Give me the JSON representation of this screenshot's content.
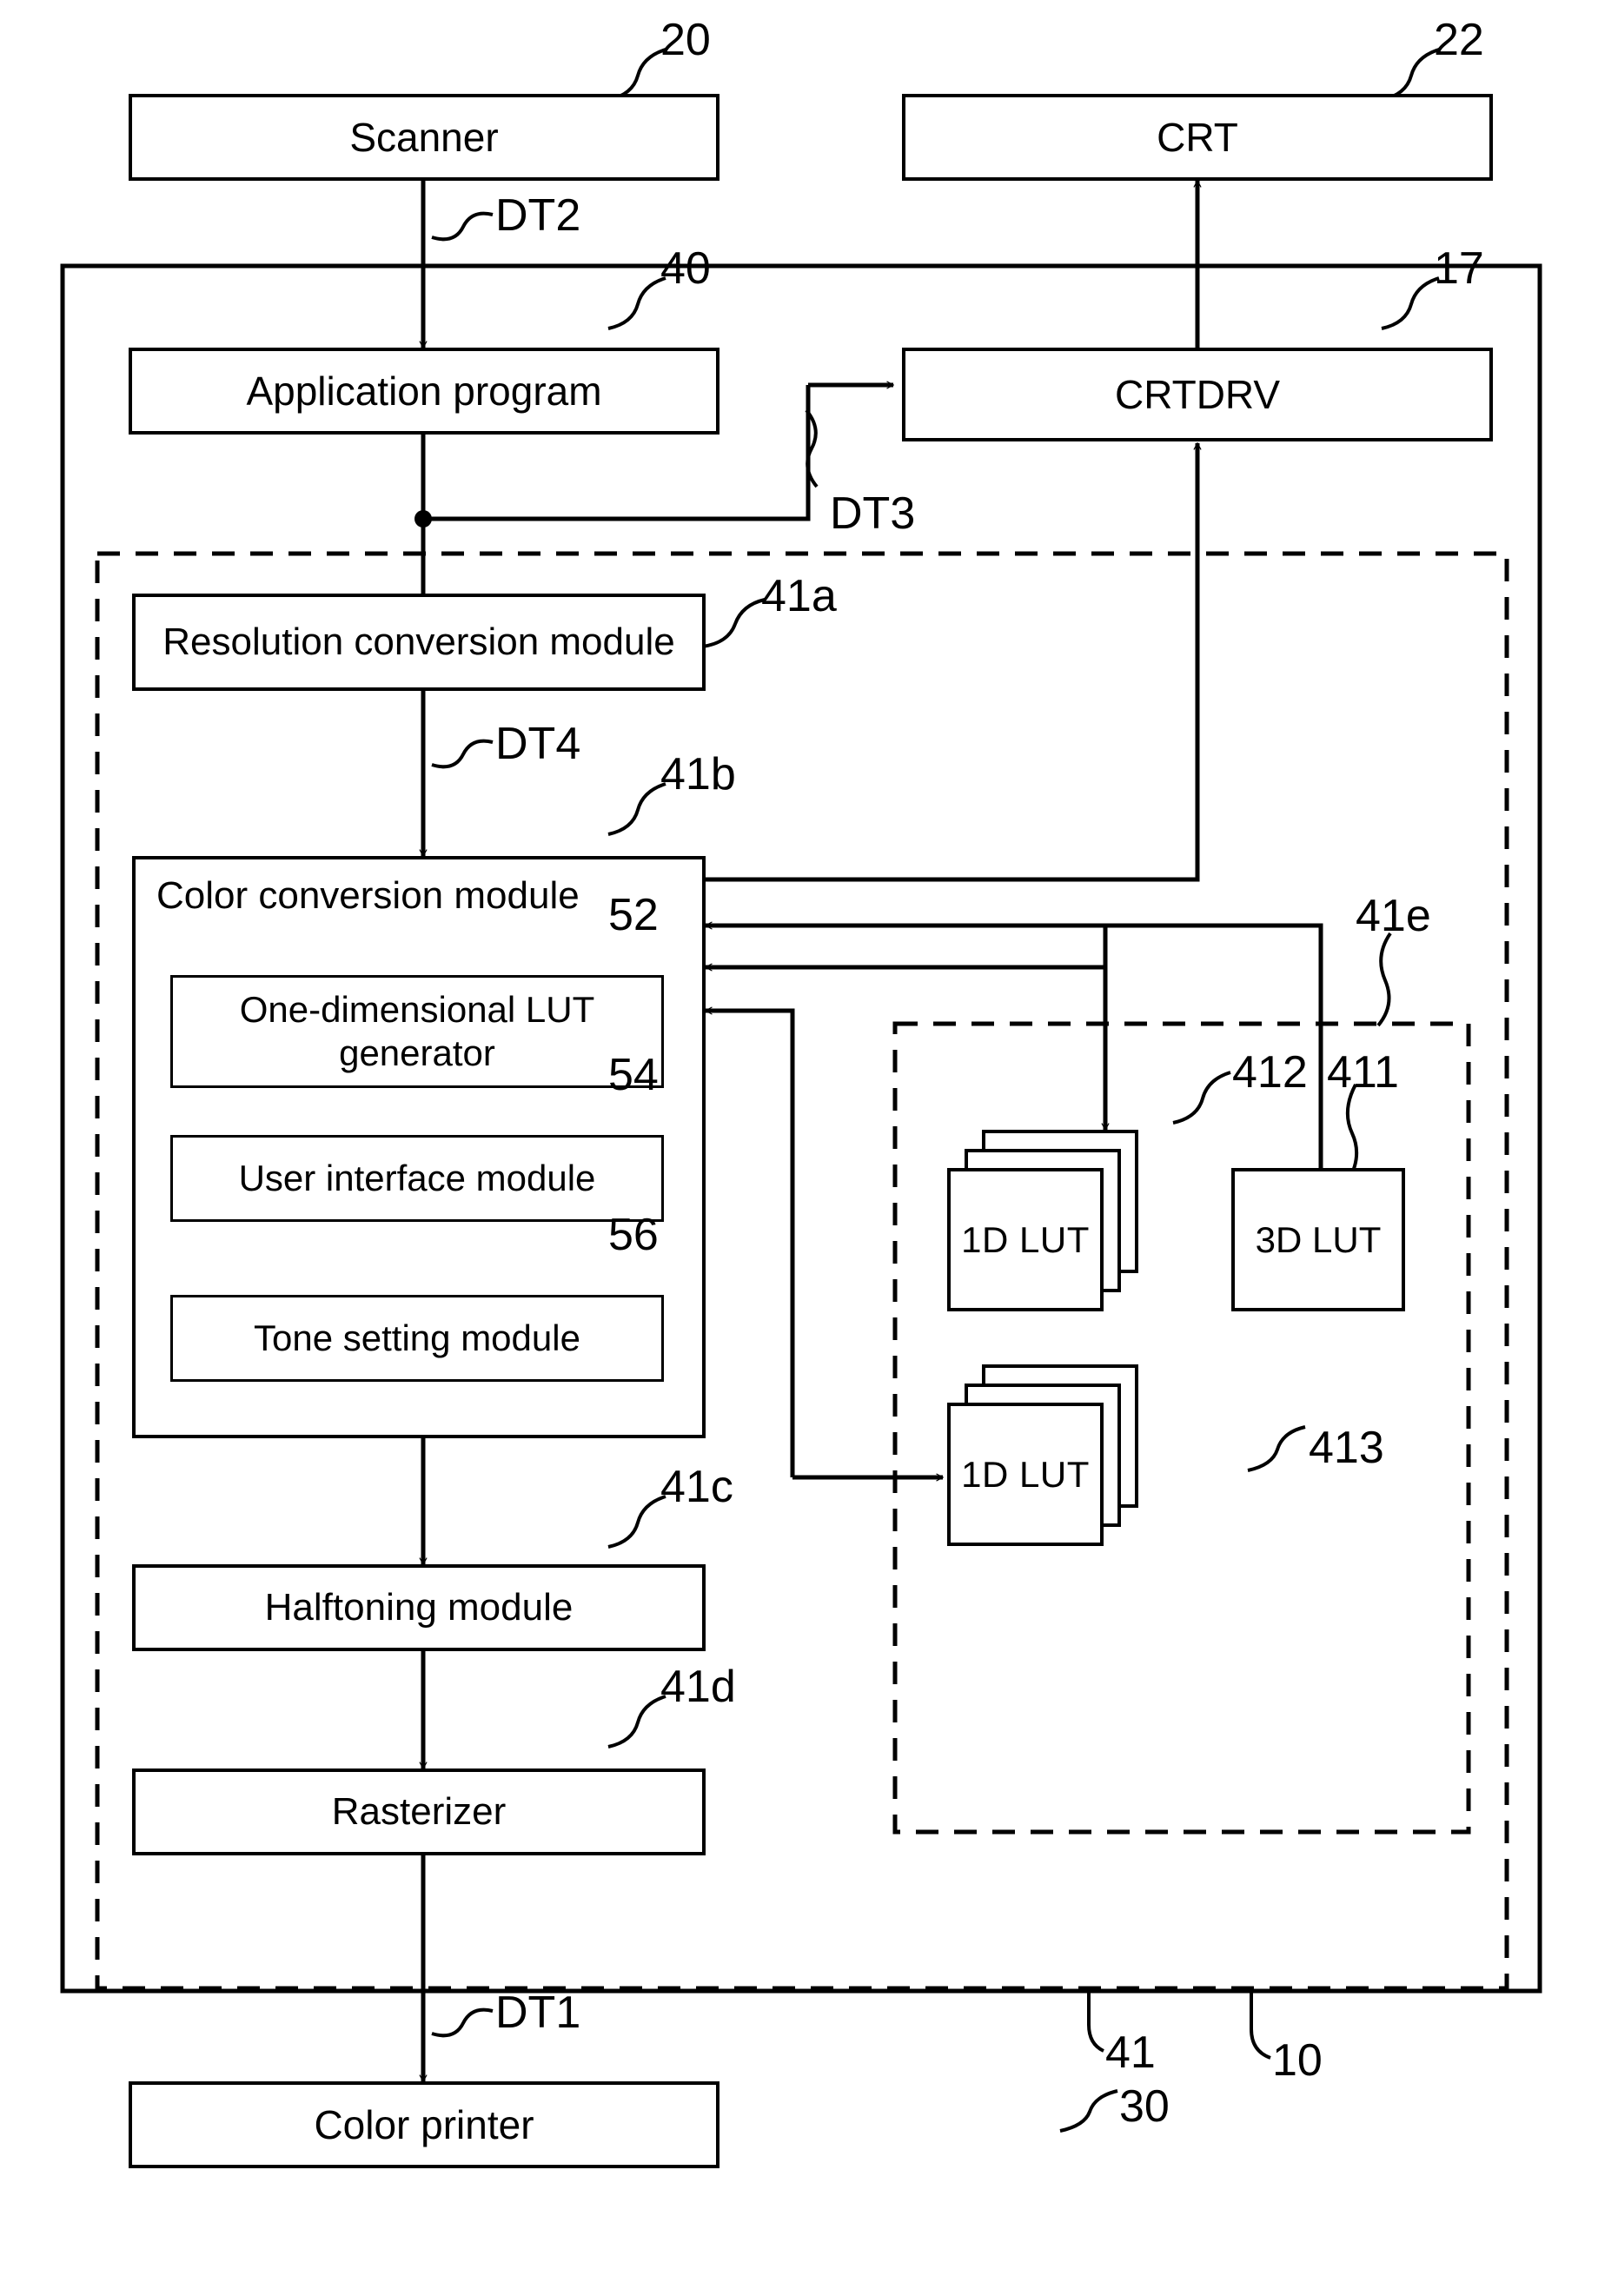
{
  "figure": {
    "type": "block-diagram",
    "title": "Color conversion / printer driver block diagram"
  },
  "boxes": {
    "scanner": "Scanner",
    "crt": "CRT",
    "application_program": "Application program",
    "crtdrv": "CRTDRV",
    "resolution_conversion_module": "Resolution conversion module",
    "color_conversion_module": "Color conversion module",
    "one_dimensional_lut_generator": "One-dimensional LUT generator",
    "user_interface_module": "User interface module",
    "tone_setting_module": "Tone setting module",
    "halftoning_module": "Halftoning module",
    "rasterizer": "Rasterizer",
    "color_printer": "Color printer",
    "lut_1d_upper": "1D LUT",
    "lut_3d": "3D LUT",
    "lut_1d_lower": "1D LUT"
  },
  "reference_numerals": {
    "scanner": "20",
    "crt": "22",
    "application_program": "40",
    "crtdrv": "17",
    "resolution_conversion_module": "41a",
    "color_conversion_module": "41b",
    "one_dimensional_lut_generator": "52",
    "user_interface_module": "54",
    "tone_setting_module": "56",
    "halftoning_module": "41c",
    "rasterizer": "41d",
    "color_printer": "30",
    "lut_group": "41e",
    "lut_3d": "411",
    "lut_1d_upper": "412",
    "lut_1d_lower": "413",
    "printer_driver_group": "41",
    "computer_group": "10"
  },
  "signal_labels": {
    "dt1": "DT1",
    "dt2": "DT2",
    "dt3": "DT3",
    "dt4": "DT4"
  },
  "colors": {
    "line": "#000000",
    "background": "#ffffff"
  }
}
